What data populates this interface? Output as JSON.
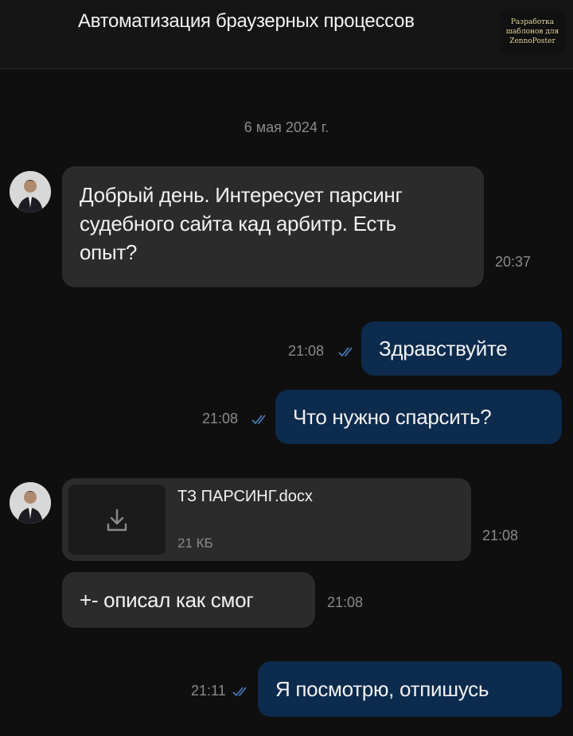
{
  "header": {
    "title": "Автоматизация браузерных процессов",
    "logo_lines": [
      "Разработка",
      "шаблонов для",
      "ZennoPoster"
    ]
  },
  "date_separator": "6 мая 2024 г.",
  "messages": [
    {
      "text": "Добрый день. Интересует парсинг судебного сайта кад арбитр. Есть опыт?",
      "time": "20:37"
    },
    {
      "text": "Здравствуйте",
      "time": "21:08"
    },
    {
      "text": "Что нужно спарсить?",
      "time": "21:08"
    },
    {
      "file_name": "ТЗ ПАРСИНГ.docx",
      "file_size": "21 КБ",
      "time": "21:08"
    },
    {
      "text": "+- описал как смог",
      "time": "21:08"
    },
    {
      "text": "Я посмотрю, отпишусь",
      "time": "21:11"
    }
  ],
  "colors": {
    "background": "#0f0f0f",
    "incoming_bubble": "#2b2b2b",
    "outgoing_bubble": "#0c2b4d",
    "read_check": "#4a7fbf"
  },
  "icons": [
    "download-icon",
    "double-check-icon",
    "avatar"
  ]
}
